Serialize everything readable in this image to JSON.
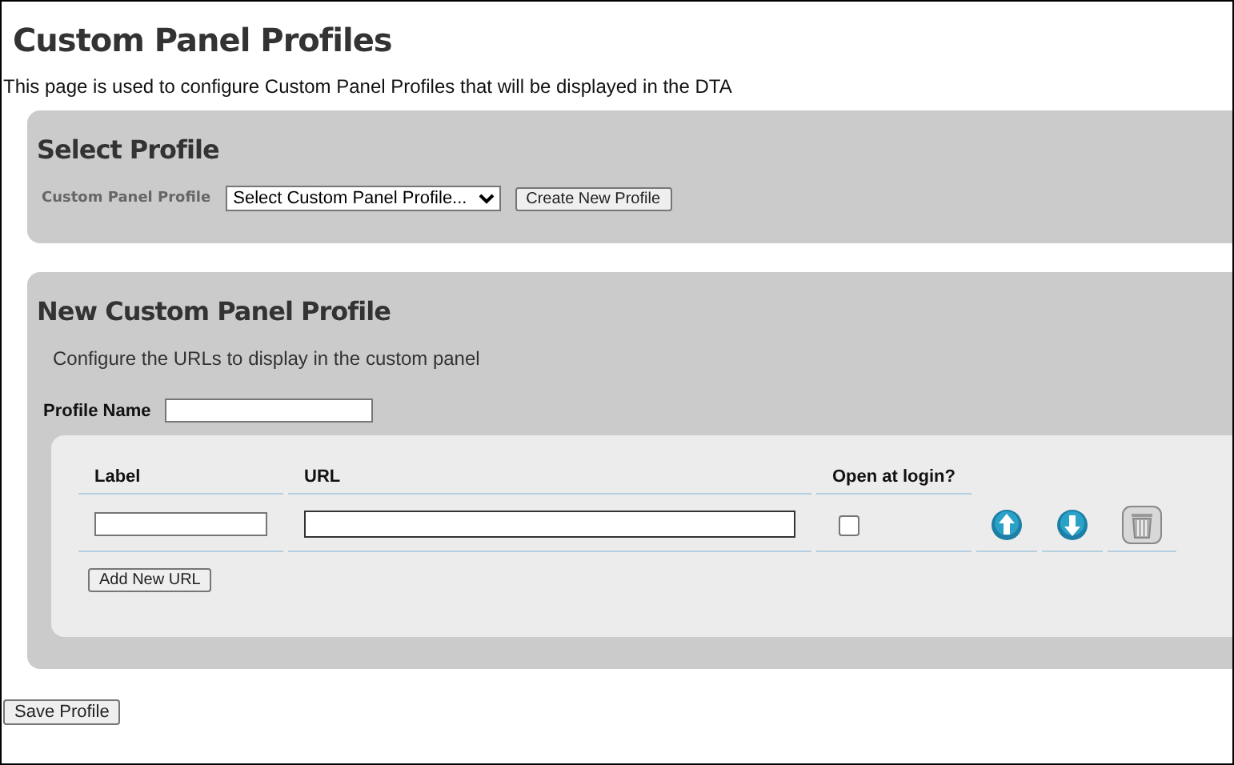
{
  "page": {
    "title": "Custom Panel Profiles",
    "description": "This page is used to configure Custom Panel Profiles that will be displayed in the DTA"
  },
  "select_profile": {
    "heading": "Select Profile",
    "field_label": "Custom Panel Profile",
    "dropdown": {
      "value": "Select Custom Panel Profile..."
    },
    "create_button": "Create New Profile"
  },
  "new_profile": {
    "heading": "New Custom Panel Profile",
    "instructions": "Configure the URLs to display in the custom panel",
    "profile_name": {
      "label": "Profile Name"
    },
    "table": {
      "columns": [
        "Label",
        "URL",
        "Open at login?"
      ],
      "rows": [
        {
          "open_at_login": false
        }
      ]
    },
    "add_button": "Add New URL"
  },
  "save_button": "Save Profile"
}
